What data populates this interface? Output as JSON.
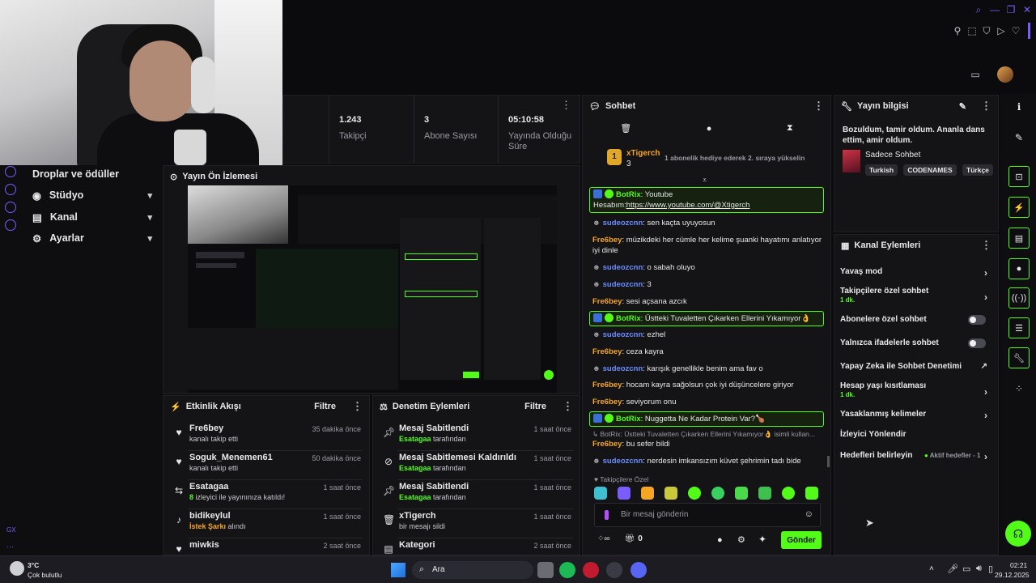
{
  "stats": [
    {
      "value": "1.243",
      "label": "Takipçi"
    },
    {
      "value": "3",
      "label": "Abone Sayısı"
    },
    {
      "value": "05:10:58",
      "label": "Yayında Olduğu Süre"
    }
  ],
  "nav": {
    "items": [
      {
        "label": "Droplar ve ödüller"
      },
      {
        "label": "Stüdyo"
      },
      {
        "label": "Kanal"
      },
      {
        "label": "Ayarlar"
      }
    ],
    "gx_label": "GX"
  },
  "preview": {
    "title": "Yayın Ön İzlemesi"
  },
  "activity": {
    "title": "Etkinlik Akışı",
    "filter": "Filtre",
    "items": [
      {
        "name": "Fre6bey",
        "sub": "kanalı takip etti",
        "time": "35 dakika önce"
      },
      {
        "name": "Soguk_Menemen61",
        "sub": "kanalı takip etti",
        "time": "50 dakika önce"
      },
      {
        "name": "Esatagaa",
        "sub_count": "8",
        "sub": "izleyici ile yayınınıza katıldı!",
        "time": "1 saat önce"
      },
      {
        "name": "bidikeylul",
        "sub_highlight": "İstek Şarkı",
        "sub": "alındı",
        "time": "1 saat önce"
      },
      {
        "name": "miwkis",
        "sub": "",
        "time": "2 saat önce"
      }
    ]
  },
  "moderation": {
    "title": "Denetim Eylemleri",
    "filter": "Filtre",
    "items": [
      {
        "name": "Mesaj Sabitlendi",
        "by": "Esatagaa",
        "sub": "tarafından",
        "time": "1 saat önce"
      },
      {
        "name": "Mesaj Sabitlemesi Kaldırıldı",
        "by": "Esatagaa",
        "sub": "tarafından",
        "time": "1 saat önce"
      },
      {
        "name": "Mesaj Sabitlendi",
        "by": "Esatagaa",
        "sub": "tarafından",
        "time": "1 saat önce"
      },
      {
        "name": "xTigerch",
        "by": "",
        "sub": "bir mesajı sildi",
        "time": "1 saat önce"
      },
      {
        "name": "Kategori",
        "by": "",
        "sub": "",
        "time": "2 saat önce"
      }
    ]
  },
  "chat": {
    "title": "Sohbet",
    "pinned": {
      "user": "xTigerch",
      "count": "3",
      "text": "1 abonelik hediye ederek 2. sıraya yükselin"
    },
    "messages": [
      {
        "user": "BotRix",
        "color": "green",
        "bot": true,
        "text": "Youtube",
        "text2": "Hesabım:",
        "link": "https://www.youtube.com/@Xtigerch"
      },
      {
        "user": "sudeozcnn",
        "color": "blue",
        "text": "sen kaçta uyuyosun"
      },
      {
        "user": "Fre6bey",
        "color": "orange",
        "text": "müzikdeki her cümle her kelime şuanki hayatımı anlatıyor iyi dinle"
      },
      {
        "user": "sudeozcnn",
        "color": "blue",
        "text": "o sabah oluyo"
      },
      {
        "user": "sudeozcnn",
        "color": "blue",
        "text": "3"
      },
      {
        "user": "Fre6bey",
        "color": "orange",
        "text": "sesi açsana azcık"
      },
      {
        "user": "BotRix",
        "color": "green",
        "bot": true,
        "text": "Üstteki Tuvaletten Çıkarken Ellerini Yıkamıyor👌"
      },
      {
        "user": "sudeozcnn",
        "color": "blue",
        "text": "ezhel"
      },
      {
        "user": "Fre6bey",
        "color": "orange",
        "text": "ceza kayra"
      },
      {
        "user": "sudeozcnn",
        "color": "blue",
        "text": "karışık genellikle benim ama fav o"
      },
      {
        "user": "Fre6bey",
        "color": "orange",
        "text": "hocam kayra sağolsun çok iyi düşüncelere giriyor"
      },
      {
        "user": "Fre6bey",
        "color": "orange",
        "text": "seviyorum onu"
      },
      {
        "user": "BotRix",
        "color": "green",
        "bot": true,
        "text": "Nuggetta Ne Kadar Protein Var?🍗"
      },
      {
        "reply": "BotRix: Üstteki Tuvaletten Çıkarken Ellerini Yıkamıyor👌 isimli kullan..."
      },
      {
        "user": "Fre6bey",
        "color": "orange",
        "text": "bu sefer bildi"
      },
      {
        "user": "sudeozcnn",
        "color": "blue",
        "text": "nerdesin imkansızım küvet şehrimin tadı bide"
      }
    ],
    "emote_section": "Takipçilere Özel",
    "input_placeholder": "Bir mesaj gönderin",
    "points": "0",
    "send": "Gönder"
  },
  "info": {
    "title": "Yayın bilgisi",
    "stream_title": "Bozuldum, tamir oldum. Ananla dans ettim, amir oldum.",
    "category": "Sadece Sohbet",
    "tags": [
      "Turkish",
      "CODENAMES",
      "Türkçe"
    ]
  },
  "actions": {
    "title": "Kanal Eylemleri",
    "items": [
      {
        "label": "Yavaş mod",
        "type": "chevron"
      },
      {
        "label": "Takipçilere özel sohbet",
        "sub": "1 dk.",
        "type": "chevron"
      },
      {
        "label": "Abonelere özel sohbet",
        "type": "toggle"
      },
      {
        "label": "Yalnızca ifadelerle sohbet",
        "type": "toggle"
      },
      {
        "label": "Yapay Zeka ile Sohbet Denetimi",
        "type": "external"
      },
      {
        "label": "Hesap yaşı kısıtlaması",
        "sub": "1 dk.",
        "type": "chevron"
      },
      {
        "label": "Yasaklanmış kelimeler",
        "type": "chevron"
      },
      {
        "label": "İzleyici Yönlendir",
        "type": "none"
      },
      {
        "label": "Hedefleri belirleyin",
        "extra": "Aktif hedefler - 1",
        "type": "chevron"
      }
    ]
  },
  "taskbar": {
    "weather_temp": "3°C",
    "weather_text": "Çok bulutlu",
    "search_placeholder": "Ara",
    "time": "02:21",
    "date": "29.12.2025"
  },
  "colors": {
    "accent": "#53fc18",
    "panel": "#141417",
    "background": "#0b0b0d"
  }
}
